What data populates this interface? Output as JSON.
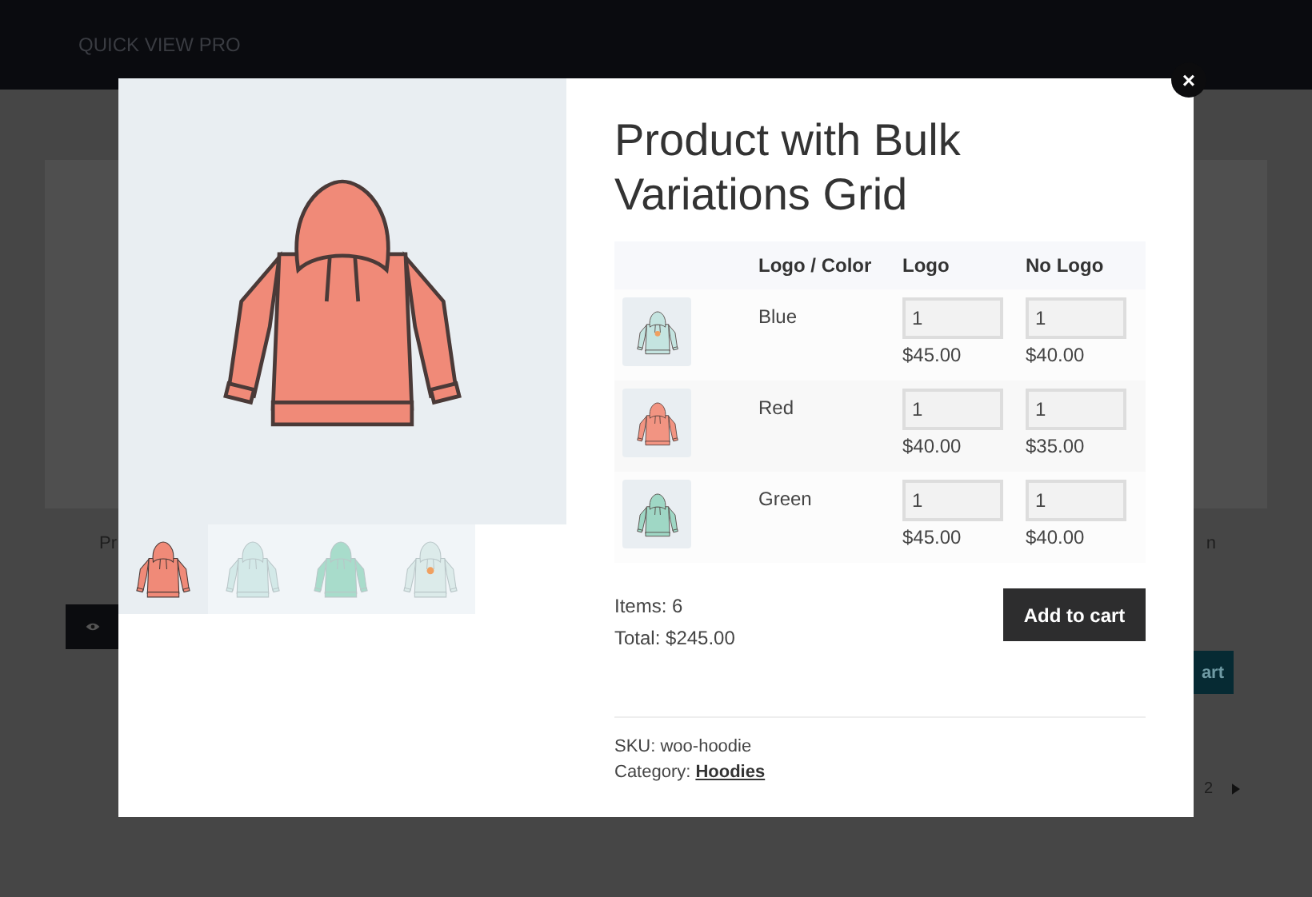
{
  "site": {
    "title": "QUICK VIEW PRO"
  },
  "background": {
    "left_text": "Pr",
    "right_text": "n",
    "cart_button": "art",
    "pagination": [
      "2"
    ]
  },
  "modal": {
    "close": "×",
    "title": "Product with Bulk Variations Grid",
    "gallery": [
      {
        "color": "#f08a78",
        "logo": false,
        "selected": true
      },
      {
        "color": "#d3e9e8",
        "logo": false,
        "selected": false
      },
      {
        "color": "#a8dccb",
        "logo": false,
        "selected": false
      },
      {
        "color": "#dcebea",
        "logo": true,
        "selected": false
      }
    ],
    "grid": {
      "columns": [
        "",
        "Logo / Color",
        "Logo",
        "No Logo"
      ],
      "rows": [
        {
          "name": "Blue",
          "color": "#c4e4e0",
          "logo": true,
          "cells": [
            {
              "quantity": "1",
              "price": "$45.00"
            },
            {
              "quantity": "1",
              "price": "$40.00"
            }
          ]
        },
        {
          "name": "Red",
          "color": "#f29482",
          "logo": false,
          "cells": [
            {
              "quantity": "1",
              "price": "$40.00"
            },
            {
              "quantity": "1",
              "price": "$35.00"
            }
          ]
        },
        {
          "name": "Green",
          "color": "#9fd7c5",
          "logo": false,
          "cells": [
            {
              "quantity": "1",
              "price": "$45.00"
            },
            {
              "quantity": "1",
              "price": "$40.00"
            }
          ]
        }
      ]
    },
    "items": "Items: 6",
    "total": "Total: $245.00",
    "button": "Add to cart",
    "sku": "SKU: woo-hoodie",
    "category_label": "Category:",
    "category": "Hoodies"
  }
}
